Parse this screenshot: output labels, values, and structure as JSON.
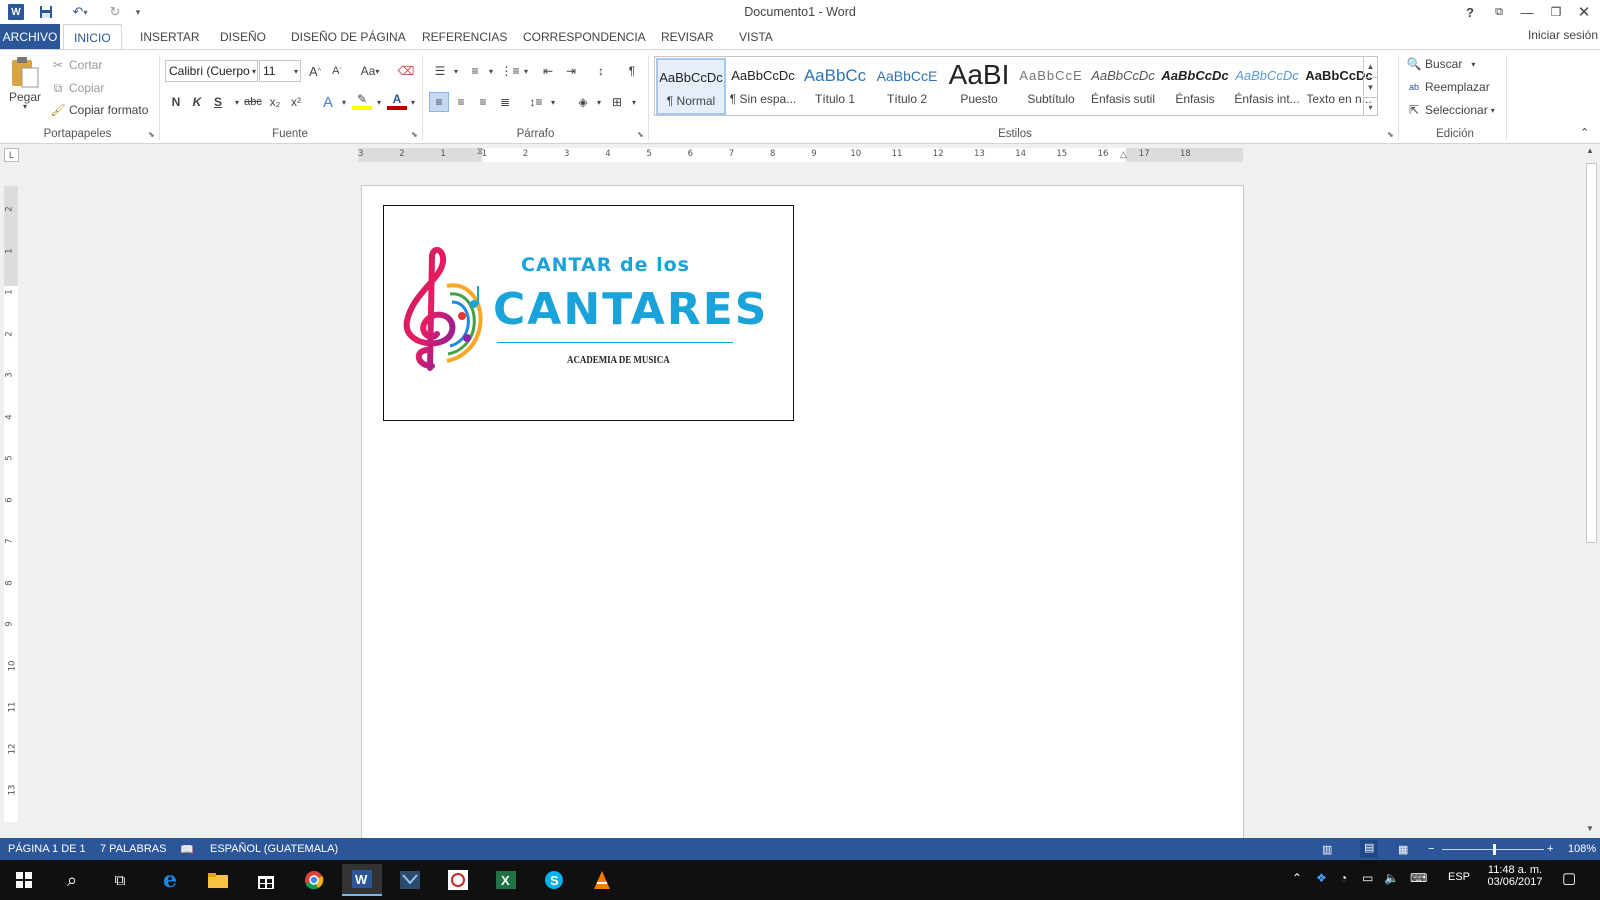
{
  "window": {
    "title": "Documento1 - Word",
    "help": "?",
    "controls": {
      "ribbon_display": "ribbon-display-icon",
      "minimize": "minimize-icon",
      "restore": "restore-icon",
      "close": "close-icon"
    }
  },
  "qat": {
    "icons": [
      "word-app-icon",
      "save-icon",
      "undo-icon",
      "redo-icon",
      "customize-qat-icon"
    ]
  },
  "tabs": [
    "ARCHIVO",
    "INICIO",
    "INSERTAR",
    "DISEÑO",
    "DISEÑO DE PÁGINA",
    "REFERENCIAS",
    "CORRESPONDENCIA",
    "REVISAR",
    "VISTA"
  ],
  "active_tab": "INICIO",
  "signin": "Iniciar sesión",
  "clipboard": {
    "label": "Portapapeles",
    "paste": "Pegar",
    "cut": "Cortar",
    "copy": "Copiar",
    "format_painter": "Copiar formato"
  },
  "font": {
    "label": "Fuente",
    "font_name": "Calibri (Cuerpo",
    "font_size": "11",
    "case": "Aa",
    "bold": "N",
    "italic": "K",
    "underline": "S",
    "strike": "abc",
    "subscript": "x₂",
    "superscript": "x²",
    "color_accent": "#c00000"
  },
  "paragraph": {
    "label": "Párrafo"
  },
  "styles": {
    "label": "Estilos",
    "items": [
      {
        "preview": "AaBbCcDc",
        "name": "¶ Normal"
      },
      {
        "preview": "AaBbCcDc",
        "name": "¶ Sin espa..."
      },
      {
        "preview": "AaBbCc",
        "name": "Título 1"
      },
      {
        "preview": "AaBbCcE",
        "name": "Título 2"
      },
      {
        "preview": "AaBI",
        "name": "Puesto"
      },
      {
        "preview": "AaBbCcE",
        "name": "Subtítulo"
      },
      {
        "preview": "AaBbCcDc",
        "name": "Énfasis sutil"
      },
      {
        "preview": "AaBbCcDc",
        "name": "Énfasis"
      },
      {
        "preview": "AaBbCcDc",
        "name": "Énfasis int..."
      },
      {
        "preview": "AaBbCcDc",
        "name": "Texto en n..."
      }
    ]
  },
  "editing": {
    "label": "Edición",
    "find": "Buscar",
    "replace": "Reemplazar",
    "select": "Seleccionar"
  },
  "ruler": {
    "h_ticks": [
      "3",
      "2",
      "1",
      "1",
      "2",
      "3",
      "4",
      "5",
      "6",
      "7",
      "8",
      "9",
      "10",
      "11",
      "12",
      "13",
      "14",
      "15",
      "16",
      "17",
      "18"
    ],
    "v_ticks": [
      "2",
      "1",
      "1",
      "2",
      "3",
      "4",
      "5",
      "6",
      "7",
      "8",
      "9",
      "10",
      "11",
      "12",
      "13"
    ],
    "corner": "L"
  },
  "document": {
    "logo": {
      "line1": "CANTAR de los",
      "line2": "CANTARES",
      "line3": "ACADEMIA DE MUSICA",
      "color": "#1aa3d8"
    }
  },
  "status": {
    "page": "PÁGINA 1 DE 1",
    "words": "7 PALABRAS",
    "language": "ESPAÑOL (GUATEMALA)",
    "zoom": "108%",
    "zoom_value": 108
  },
  "taskbar": {
    "apps": [
      "windows-start-icon",
      "search-icon",
      "task-view-icon",
      "edge-icon",
      "file-explorer-icon",
      "store-icon",
      "chrome-icon",
      "word-icon",
      "visual-studio-icon",
      "corel-icon",
      "excel-icon",
      "skype-icon",
      "vlc-icon"
    ],
    "lang": "ESP",
    "time": "11:48 a. m.",
    "date": "03/06/2017"
  }
}
